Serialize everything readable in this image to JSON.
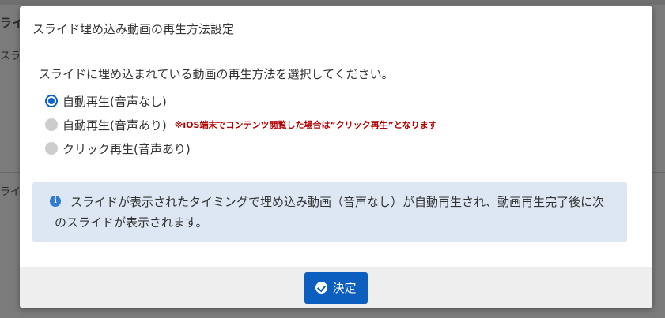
{
  "background": {
    "label_top": "ライ",
    "label_mid": "スライ",
    "label_low": "ライ"
  },
  "modal": {
    "title": "スライド埋め込み動画の再生方法設定",
    "prompt": "スライドに埋め込まれている動画の再生方法を選択してください。",
    "options": [
      {
        "label": "自動再生(音声なし)",
        "selected": true,
        "note": ""
      },
      {
        "label": "自動再生(音声あり)",
        "selected": false,
        "note": "※iOS端末でコンテンツ閲覧した場合は“クリック再生”となります"
      },
      {
        "label": "クリック再生(音声あり)",
        "selected": false,
        "note": ""
      }
    ],
    "info": {
      "icon": "info-icon",
      "text": "スライドが表示されたタイミングで埋め込み動画（音声なし）が自動再生され、動画再生完了後に次のスライドが表示されます。"
    },
    "confirm_label": "決定"
  },
  "colors": {
    "accent": "#0d5fbf",
    "note": "#b30000",
    "info_bg": "#dde7f3"
  }
}
